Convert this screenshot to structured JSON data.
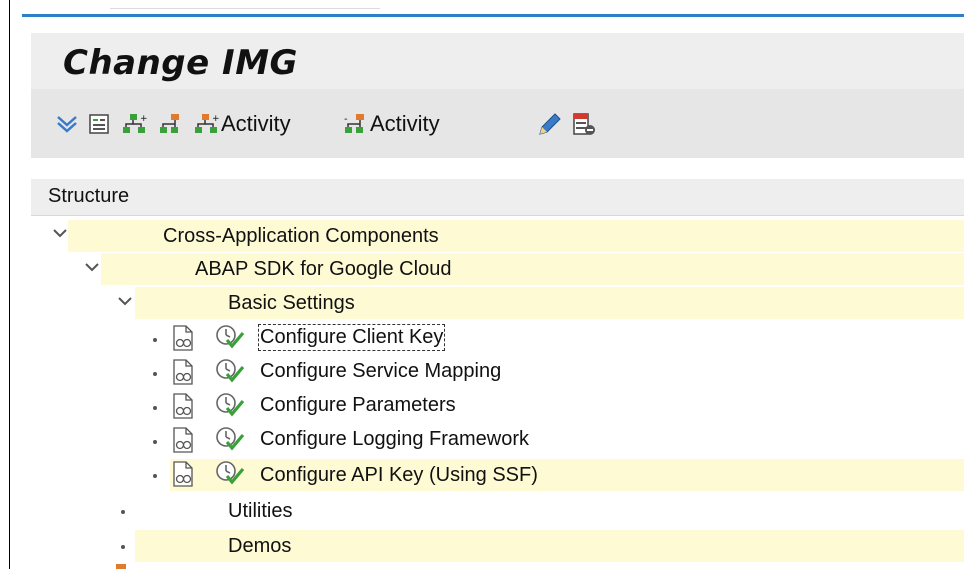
{
  "title": "Change IMG",
  "toolbar": {
    "items": [
      {
        "icon": "expand-all-icon"
      },
      {
        "icon": "details-icon"
      },
      {
        "icon": "add-node-icon"
      },
      {
        "icon": "where-used-icon"
      },
      {
        "icon": "add-activity-icon",
        "label": "Activity"
      },
      {
        "icon": "remove-activity-icon",
        "label": "Activity"
      },
      {
        "icon": "pencil-icon"
      },
      {
        "icon": "delete-lines-icon"
      }
    ]
  },
  "structure": {
    "header": "Structure",
    "tree": [
      {
        "label": "Cross-Application Components",
        "level": 0,
        "expanded": true,
        "highlighted": true
      },
      {
        "label": "ABAP SDK for Google Cloud",
        "level": 1,
        "expanded": true,
        "highlighted": true
      },
      {
        "label": "Basic Settings",
        "level": 2,
        "expanded": true,
        "highlighted": true
      },
      {
        "label": "Configure Client Key",
        "level": 3,
        "activity": true,
        "focused": true
      },
      {
        "label": "Configure Service Mapping",
        "level": 3,
        "activity": true
      },
      {
        "label": "Configure Parameters",
        "level": 3,
        "activity": true
      },
      {
        "label": "Configure Logging Framework",
        "level": 3,
        "activity": true
      },
      {
        "label": "Configure API Key (Using SSF)",
        "level": 3,
        "activity": true,
        "highlighted": true
      },
      {
        "label": "Utilities",
        "level": 2,
        "expanded": false
      },
      {
        "label": "Demos",
        "level": 2,
        "expanded": false,
        "highlighted": true
      }
    ]
  },
  "colors": {
    "highlight": "#fefbd4",
    "accent": "#2e7fc8",
    "check_green": "#3aa03a"
  }
}
